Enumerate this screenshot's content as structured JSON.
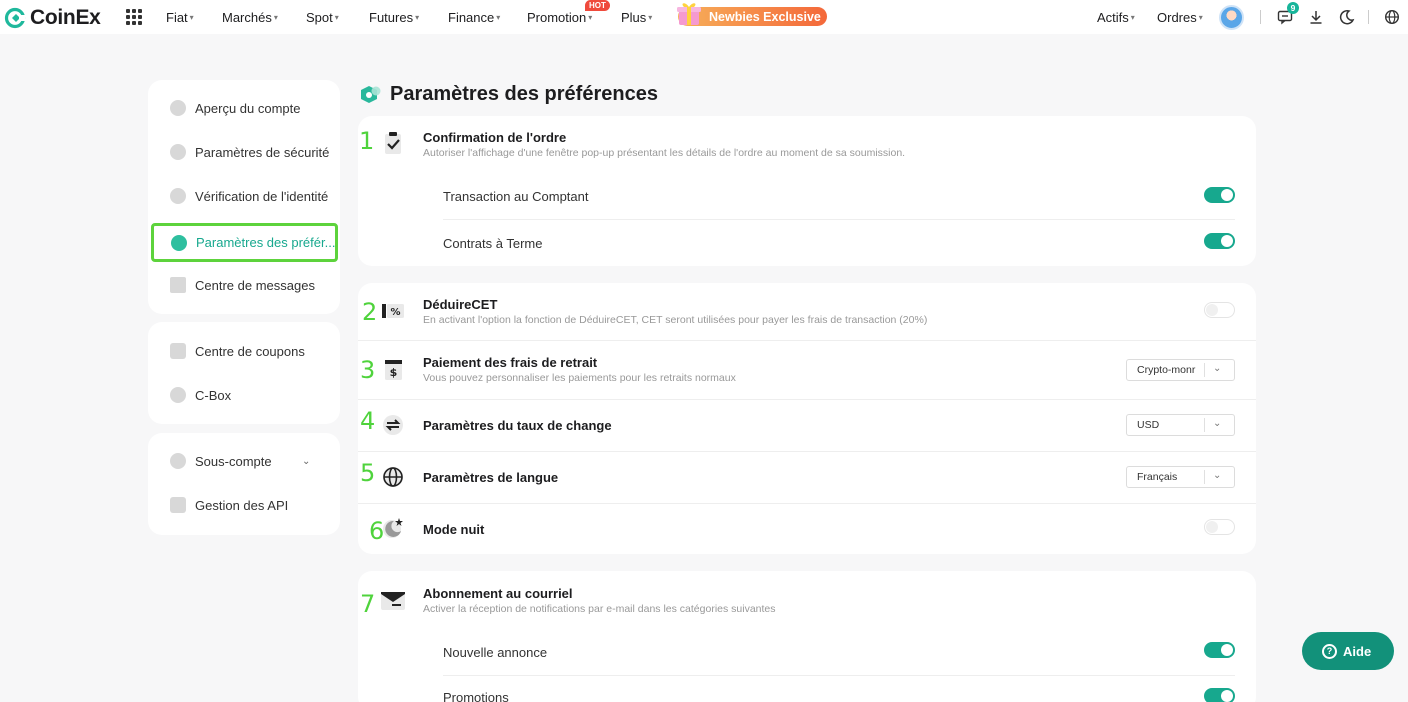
{
  "header": {
    "brand": "CoinEx",
    "nav": [
      {
        "label": "Fiat"
      },
      {
        "label": "Marchés"
      },
      {
        "label": "Spot"
      },
      {
        "label": "Futures"
      },
      {
        "label": "Finance"
      },
      {
        "label": "Promotion"
      },
      {
        "label": "Plus"
      }
    ],
    "hot_badge": "HOT",
    "newbies": "Newbies Exclusive",
    "right_nav": [
      {
        "label": "Actifs"
      },
      {
        "label": "Ordres"
      }
    ],
    "notification_count": "9",
    "caret": "▾"
  },
  "sidebar": {
    "group1": [
      {
        "label": "Aperçu du compte",
        "icon": "pie-chart-icon"
      },
      {
        "label": "Paramètres de sécurité",
        "icon": "shield-icon"
      },
      {
        "label": "Vérification de l'identité",
        "icon": "id-card-icon"
      },
      {
        "label": "Paramètres des préfér...",
        "icon": "preferences-icon"
      },
      {
        "label": "Centre de messages",
        "icon": "message-icon"
      }
    ],
    "group2": [
      {
        "label": "Centre de coupons",
        "icon": "coupon-icon"
      },
      {
        "label": "C-Box",
        "icon": "box-icon"
      }
    ],
    "group3": [
      {
        "label": "Sous-compte",
        "icon": "sub-account-icon"
      },
      {
        "label": "Gestion des API",
        "icon": "api-icon"
      }
    ],
    "chevron": "⌄"
  },
  "main": {
    "title": "Paramètres des préférences",
    "sections": {
      "order": {
        "num": "1",
        "title": "Confirmation de l'ordre",
        "desc": "Autoriser l'affichage d'une fenêtre pop-up présentant les détails de l'ordre au moment de sa soumission.",
        "rows": [
          {
            "label": "Transaction au Comptant",
            "on": true
          },
          {
            "label": "Contrats à Terme",
            "on": true
          }
        ]
      },
      "cet": {
        "num": "2",
        "title": "DéduireCET",
        "desc": "En activant l'option la fonction de DéduireCET, CET seront utilisées pour payer les frais de transaction (20%)",
        "on": false
      },
      "withdraw": {
        "num": "3",
        "title": "Paiement des frais de retrait",
        "desc": "Vous pouvez personnaliser les paiements pour les retraits normaux",
        "value": "Crypto-monr"
      },
      "rate": {
        "num": "4",
        "title": "Paramètres du taux de change",
        "value": "USD"
      },
      "language": {
        "num": "5",
        "title": "Paramètres de langue",
        "value": "Français"
      },
      "night": {
        "num": "6",
        "title": "Mode nuit",
        "on": false
      },
      "email": {
        "num": "7",
        "title": "Abonnement au courriel",
        "desc": "Activer la réception de notifications par e-mail dans les catégories suivantes",
        "rows": [
          {
            "label": "Nouvelle annonce",
            "on": true
          },
          {
            "label": "Promotions",
            "on": true
          }
        ]
      }
    }
  },
  "help": {
    "label": "Aide"
  },
  "colors": {
    "accent": "#17a88e",
    "highlight": "#5dd33c",
    "number": "#4fd33c",
    "newbies": "#f4683a"
  }
}
